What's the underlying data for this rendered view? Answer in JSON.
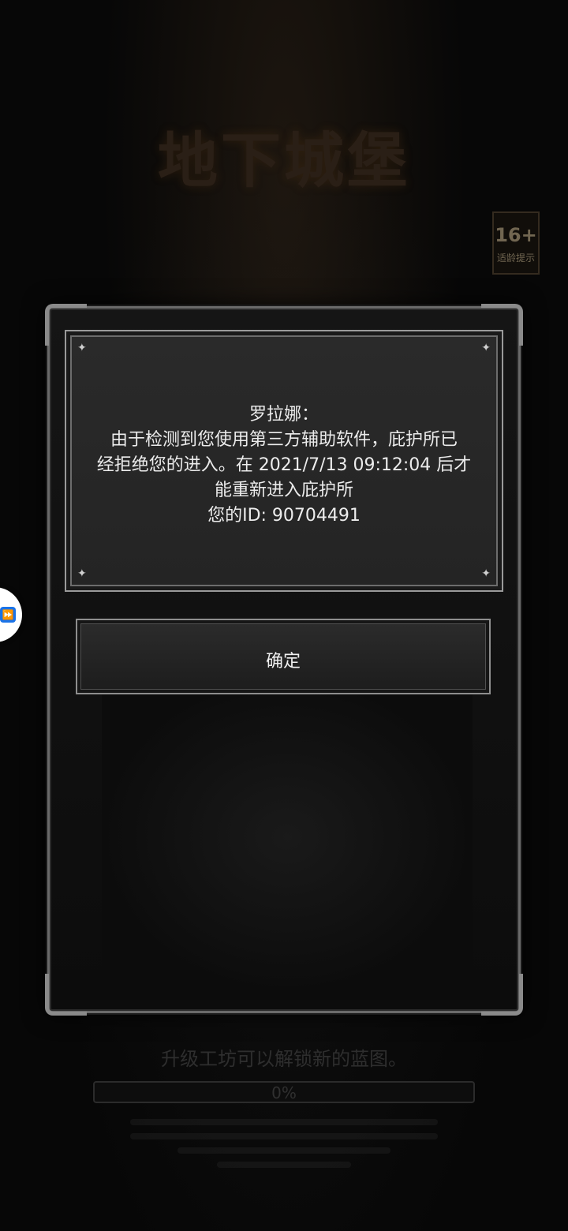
{
  "header": {
    "logo_title": "地下城堡",
    "age_rating": {
      "number": "16+",
      "label": "适龄提示"
    }
  },
  "dialog": {
    "message_lines": [
      "罗拉娜：",
      "由于检测到您使用第三方辅助软件，庇护所已",
      "经拒绝您的进入。在 2021/7/13 09:12:04 后才",
      "能重新进入庇护所",
      "您的ID: 90704491"
    ],
    "confirm_label": "确定"
  },
  "loading": {
    "tip": "升级工坊可以解锁新的蓝图。",
    "progress_text": "0%",
    "progress_value": 0
  },
  "icons": {
    "floating": "fast-forward-icon",
    "sparkle": "sparkle-icon"
  }
}
